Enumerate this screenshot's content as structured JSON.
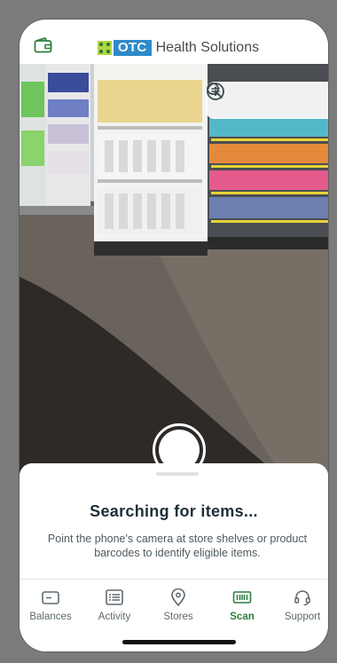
{
  "header": {
    "logo_otc": "OTC",
    "logo_text": "Health Solutions"
  },
  "camera": {
    "toolbar": {
      "search_icon": "search-icon",
      "filter_icon": "filter-list-icon",
      "info_icon": "info-icon"
    }
  },
  "sheet": {
    "title": "Searching for items...",
    "description": "Point the phone's camera at store shelves or product barcodes to identify eligible items."
  },
  "tabs": [
    {
      "label": "Balances",
      "icon": "wallet-card-icon",
      "active": false
    },
    {
      "label": "Activity",
      "icon": "list-icon",
      "active": false
    },
    {
      "label": "Stores",
      "icon": "location-pin-icon",
      "active": false
    },
    {
      "label": "Scan",
      "icon": "barcode-icon",
      "active": true
    },
    {
      "label": "Support",
      "icon": "headset-icon",
      "active": false
    }
  ],
  "colors": {
    "accent_green": "#2c7f3e",
    "logo_blue": "#2e8ac9",
    "logo_lime": "#b7d341",
    "title_text": "#1f2f36"
  }
}
